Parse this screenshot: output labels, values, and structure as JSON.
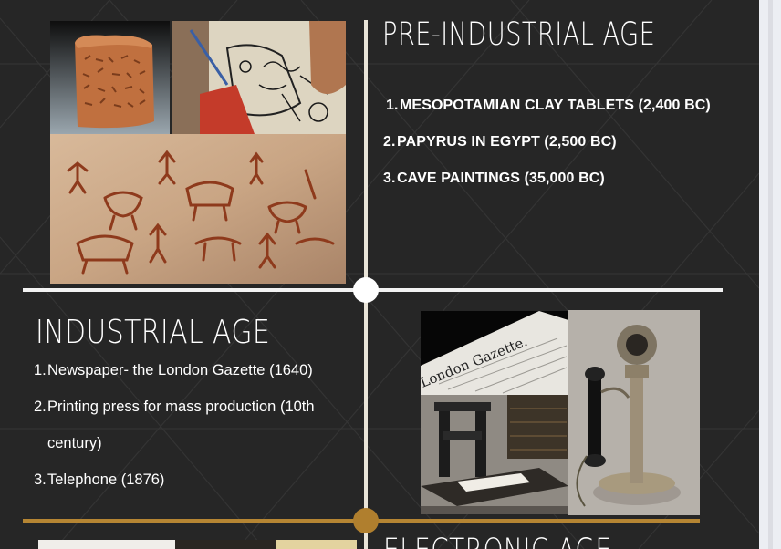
{
  "slide": {
    "pre_industrial": {
      "title": "PRE-INDUSTRIAL AGE",
      "items": [
        {
          "num": "1.",
          "text": "MESOPOTAMIAN CLAY TABLETS  (2,400 BC)"
        },
        {
          "num": "2.",
          "text": "PAPYRUS IN EGYPT  (2,500 BC)"
        },
        {
          "num": "3.",
          "text": "CAVE PAINTINGS (35,000 BC)"
        }
      ]
    },
    "industrial": {
      "title": "INDUSTRIAL AGE",
      "items": [
        {
          "num": "1.",
          "text": "Newspaper- the London Gazette (1640)"
        },
        {
          "num": "2.",
          "text": "Printing press for mass production (10th century)"
        },
        {
          "num": "3.",
          "text": "Telephone (1876)"
        }
      ]
    },
    "electronic": {
      "title": "ELECTRONIC AGE"
    },
    "images": {
      "newspaper_text": "London Gazette."
    }
  },
  "colors": {
    "background": "#262626",
    "timeline_white": "#f2f2f2",
    "timeline_gold": "#b58533",
    "text": "#ffffff"
  }
}
